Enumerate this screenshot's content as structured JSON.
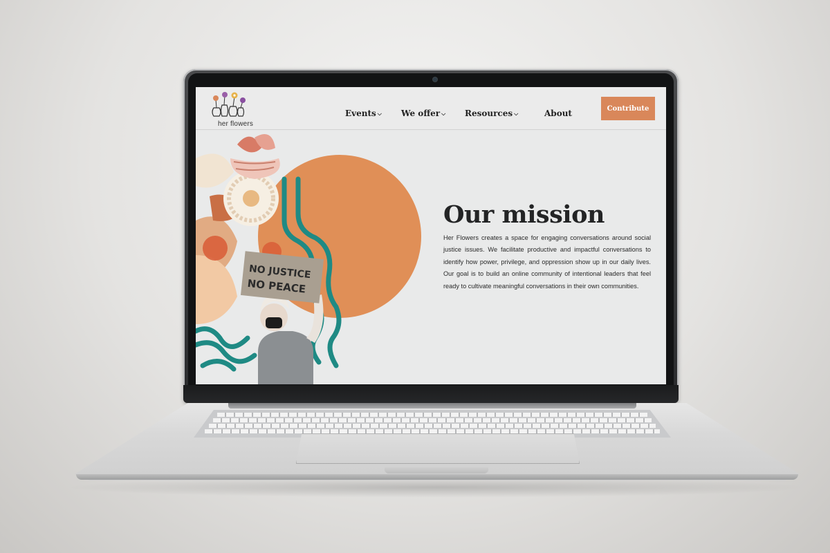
{
  "logo": {
    "text": "her flowers",
    "icon": "flower-vases-logo"
  },
  "nav": {
    "items": [
      {
        "label": "Events",
        "has_dropdown": true
      },
      {
        "label": "We offer",
        "has_dropdown": true
      },
      {
        "label": "Resources",
        "has_dropdown": true
      },
      {
        "label": "About",
        "has_dropdown": false
      }
    ],
    "cta_label": "Contribute"
  },
  "hero": {
    "sign_line1": "NO JUSTICE",
    "sign_line2": "NO PEACE",
    "title": "Our mission",
    "body": "Her Flowers creates a space for engaging conversations around social justice issues. We facilitate productive and impactful conversations to identify how power, privilege, and oppression show up in our daily lives. Our goal is to build an online community of intentional leaders that feel ready to cultivate meaningful conversations in their own communities."
  },
  "colors": {
    "accent": "#d9875a",
    "circle": "#e08f57",
    "teal": "#1f8a84",
    "text": "#232425",
    "page_bg": "#e9eaea"
  }
}
